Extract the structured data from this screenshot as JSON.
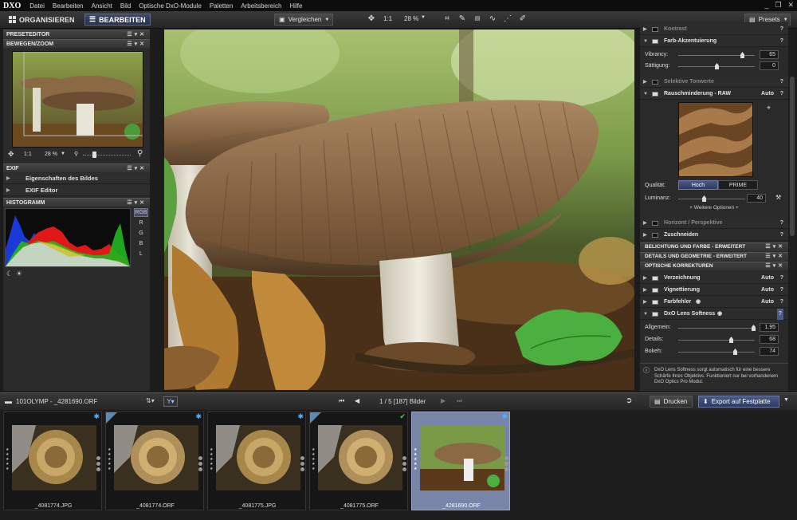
{
  "app": {
    "logo": "DXO",
    "window_controls": [
      "_",
      "❐",
      "✕"
    ]
  },
  "menu": [
    "Datei",
    "Bearbeiten",
    "Ansicht",
    "Bild",
    "Optische DxO-Module",
    "Paletten",
    "Arbeitsbereich",
    "Hilfe"
  ],
  "modes": {
    "organize": "ORGANISIEREN",
    "edit": "BEARBEITEN"
  },
  "toolbar": {
    "compare": "Vergleichen",
    "ratio": "1:1",
    "zoom": "28 %",
    "presets": "Presets"
  },
  "left": {
    "preset_editor": "PRESETEDITOR",
    "move_zoom": "BEWEGEN/ZOOM",
    "nav_ratio": "1:1",
    "nav_zoom": "28 %",
    "exif": "EXIF",
    "exif_items": [
      "Eigenschaften des Bildes",
      "EXIF Editor"
    ],
    "histogram": "HISTOGRAMM",
    "hist_channels": [
      "RGB",
      "R",
      "G",
      "B",
      "L"
    ]
  },
  "right": {
    "kontrast": "Kontrast",
    "farb_akzent": "Farb-Akzentuierung",
    "vibrancy_label": "Vibrancy:",
    "vibrancy_value": "65",
    "saettigung_label": "Sättigung:",
    "saettigung_value": "0",
    "selektive": "Selektive Tonwerte",
    "rausch": "Rauschminderung - RAW",
    "auto": "Auto",
    "qualitaet_label": "Qualität:",
    "qual_hoch": "Hoch",
    "qual_prime": "PRIME",
    "luminanz_label": "Luminanz:",
    "luminanz_value": "40",
    "weitere": "+ Weitere Optionen +",
    "horizont": "Horizont / Perspektive",
    "zuschneiden": "Zuschneiden",
    "bar1": "BELICHTUNG UND FARBE - ERWEITERT",
    "bar2": "DETAILS UND GEOMETRIE - ERWEITERT",
    "bar3": "OPTISCHE KORREKTUREN",
    "verzeichnung": "Verzeichnung",
    "vignettierung": "Vignettierung",
    "farbfehler": "Farbfehler",
    "lens": "DxO Lens Softness",
    "allgemein_label": "Allgemein:",
    "allgemein_value": "1.95",
    "details_label": "Details:",
    "details_value": "68",
    "bokeh_label": "Bokeh:",
    "bokeh_value": "74",
    "info": "DxO Lens Softness sorgt automatisch für eine bessere Schärfe Ihres Objektivs. Funktioniert nur bei vorhandenem DxO Optics Pro Modul."
  },
  "filmbar": {
    "folder": "101OLYMP - _4281690.ORF",
    "counter": "1 / 5 [187] Bilder",
    "print": "Drucken",
    "export": "Export auf Festplatte"
  },
  "thumbs": [
    {
      "name": "_4081774.JPG"
    },
    {
      "name": "_4081774.ORF"
    },
    {
      "name": "_4081775.JPG"
    },
    {
      "name": "_4081775.ORF"
    },
    {
      "name": "_4281690.ORF"
    }
  ],
  "colors": {
    "accent": "#3c4a68",
    "selected_thumb": "#7885a8",
    "flag_blue": "#4fb0ff"
  }
}
